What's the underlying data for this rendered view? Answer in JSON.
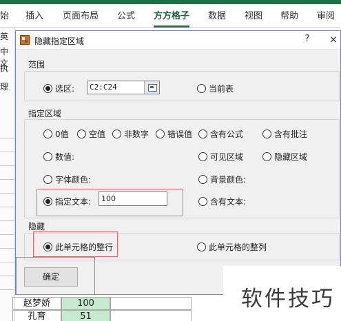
{
  "ribbon": {
    "tabs": [
      "始",
      "插入",
      "页面布局",
      "公式",
      "方方格子",
      "数据",
      "视图",
      "帮助",
      "审阅"
    ]
  },
  "sheet": {
    "left_labels": [
      "英",
      "中文",
      "执",
      "理"
    ],
    "rows": [
      {
        "name": "赵梦娇",
        "value": "100"
      },
      {
        "name": "孔育",
        "value": "51"
      }
    ]
  },
  "dialog": {
    "title": "隐藏指定区域",
    "help_label": "?",
    "close_label": "×",
    "range_group": {
      "label": "范围",
      "selection_label": "选区:",
      "selection_value": "C2:C24",
      "current_sheet_label": "当前表",
      "selected": "selection"
    },
    "area_group": {
      "label": "指定区域",
      "options": {
        "zero": "0值",
        "blank": "空值",
        "non_numeric": "非数字",
        "error": "错误值",
        "formula": "含有公式",
        "comment": "含有批注",
        "numeric": "数值:",
        "visible": "可见区域",
        "hidden": "隐藏区域",
        "font_color": "字体颜色:",
        "bg_color": "背景颜色:",
        "specified_text": "指定文本:",
        "contains_text": "含有文本:"
      },
      "specified_text_value": "100",
      "selected": "specified_text"
    },
    "hide_group": {
      "label": "隐藏",
      "row_label": "此单元格的整行",
      "col_label": "此单元格的整列",
      "selected": "row"
    },
    "ok_label": "确定"
  },
  "watermark": "软件技巧",
  "colors": {
    "excel_green": "#1e7145",
    "highlight": "#e56c6c",
    "cell_green": "#c6e9cf"
  }
}
